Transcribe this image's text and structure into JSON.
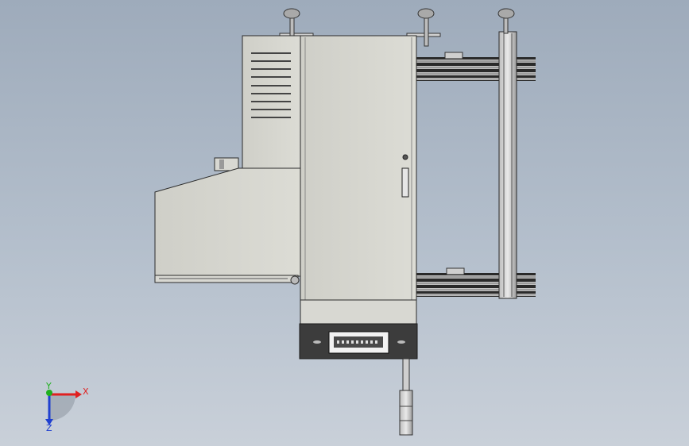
{
  "triad": {
    "x_label": "X",
    "y_label": "Y",
    "z_label": "Z",
    "x_color": "#e02020",
    "y_color": "#20b020",
    "z_color": "#2040d0"
  },
  "model": {
    "body_color": "#d5d5cf",
    "panel_dark": "#3a3a3a",
    "outline": "#2b2b2b",
    "rail_color": "#9a9a9a"
  }
}
